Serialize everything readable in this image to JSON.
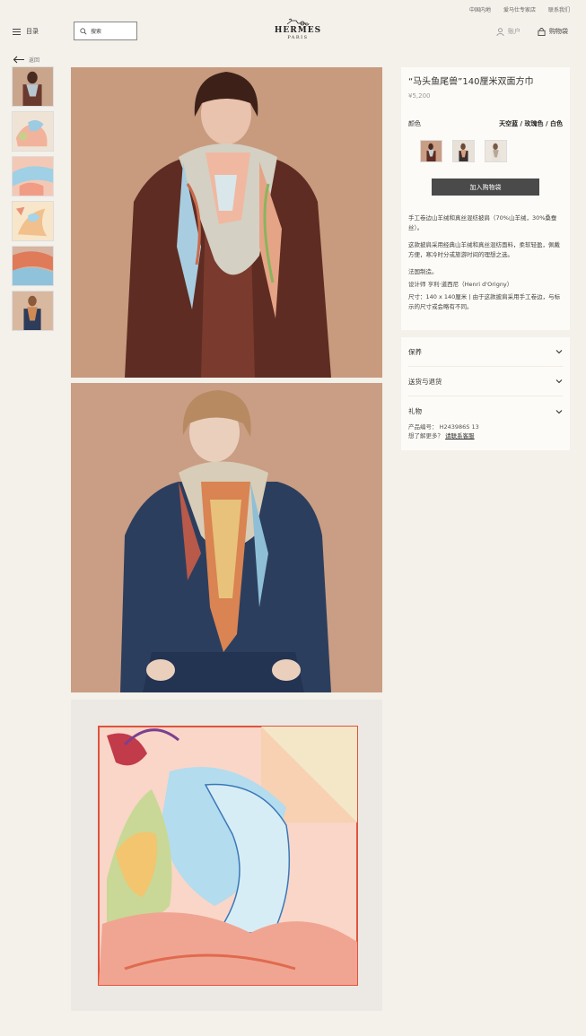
{
  "topbar": {
    "region": "中国内地",
    "contact": "爱马仕专家店",
    "follow": "联系我们"
  },
  "header": {
    "menu_label": "目录",
    "search_placeholder": "搜索",
    "brand": "HERMES",
    "city": "PARIS",
    "account_label": "账户",
    "bag_label": "购物袋"
  },
  "nav": {
    "back_label": "返回"
  },
  "product": {
    "title": "“马头鱼尾兽”140厘米双面方巾",
    "price": "¥5,200",
    "color_label": "颜色",
    "color_value": "天空蓝 / 玫瑰色 / 白色",
    "add_to_bag": "加入购物袋",
    "description": [
      "手工卷边山羊绒和真丝混纺披肩（70%山羊绒，30%桑蚕丝）。",
      "这款披肩采用经典山羊绒和真丝混纺面料，柔软轻盈，佩戴方便，寒冷时分或旅游时间的理想之选。",
      "法国制造。",
      "设计师 亨利·道西尼（Henri d'Origny）",
      "尺寸：140 x 140厘米 | 由于这款披肩采用手工卷边，与标示的尺寸或会略有不同。"
    ]
  },
  "accordion": {
    "care": "保养",
    "delivery": "送货与退货",
    "gift": "礼物"
  },
  "meta": {
    "ref_label": "产品编号：",
    "ref_value": "H243986S 13",
    "help_text": "想了解更多？",
    "help_link": "请联系客服"
  },
  "colors": {
    "background": "#f4f0ea",
    "panel": "#fdfbf7",
    "button": "#4a4a4a",
    "photo_bg": "#c79a7c",
    "scarf_sky": "#a9d3e8",
    "scarf_rose": "#f2a98f"
  }
}
